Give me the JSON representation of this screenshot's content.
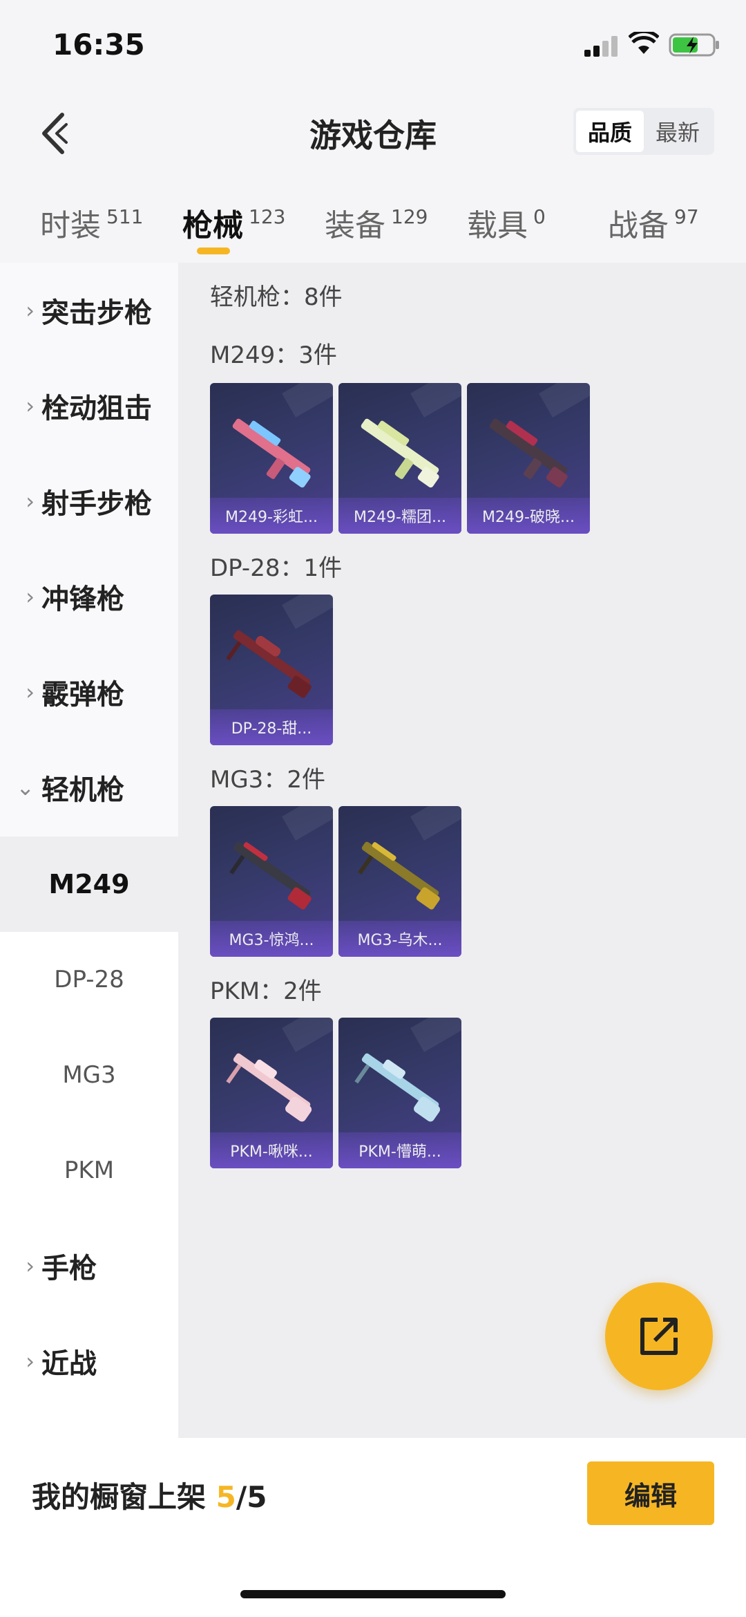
{
  "status": {
    "time": "16:35"
  },
  "header": {
    "title": "游戏仓库",
    "sort_options": [
      "品质",
      "最新"
    ],
    "sort_selected": "品质"
  },
  "tabs": [
    {
      "label": "时装",
      "count": "511"
    },
    {
      "label": "枪械",
      "count": "123",
      "active": true
    },
    {
      "label": "装备",
      "count": "129"
    },
    {
      "label": "载具",
      "count": "0"
    },
    {
      "label": "战备",
      "count": "97"
    }
  ],
  "sidebar": {
    "categories": [
      {
        "label": "突击步枪"
      },
      {
        "label": "栓动狙击"
      },
      {
        "label": "射手步枪"
      },
      {
        "label": "冲锋枪"
      },
      {
        "label": "霰弹枪"
      },
      {
        "label": "轻机枪",
        "expanded": true
      }
    ],
    "subitems": [
      "M249",
      "DP-28",
      "MG3",
      "PKM"
    ],
    "selected_sub": "M249",
    "more": [
      {
        "label": "手枪"
      },
      {
        "label": "近战"
      }
    ]
  },
  "main": {
    "category_header": "轻机枪：8件",
    "groups": [
      {
        "header": "M249：3件",
        "items": [
          "M249-彩虹...",
          "M249-糯团...",
          "M249-破晓..."
        ]
      },
      {
        "header": "DP-28：1件",
        "items": [
          "DP-28-甜..."
        ]
      },
      {
        "header": "MG3：2件",
        "items": [
          "MG3-惊鸿...",
          "MG3-乌木..."
        ]
      },
      {
        "header": "PKM：2件",
        "items": [
          "PKM-啾咪...",
          "PKM-懵萌..."
        ]
      }
    ]
  },
  "bottom": {
    "label": "我的橱窗上架",
    "count": "5",
    "total": "/5",
    "edit_label": "编辑"
  },
  "colors": {
    "accent": "#f6b624",
    "card_bg": "#353a69"
  },
  "icons": {
    "back": "back-chevron-icon",
    "fab": "share-export-icon"
  }
}
